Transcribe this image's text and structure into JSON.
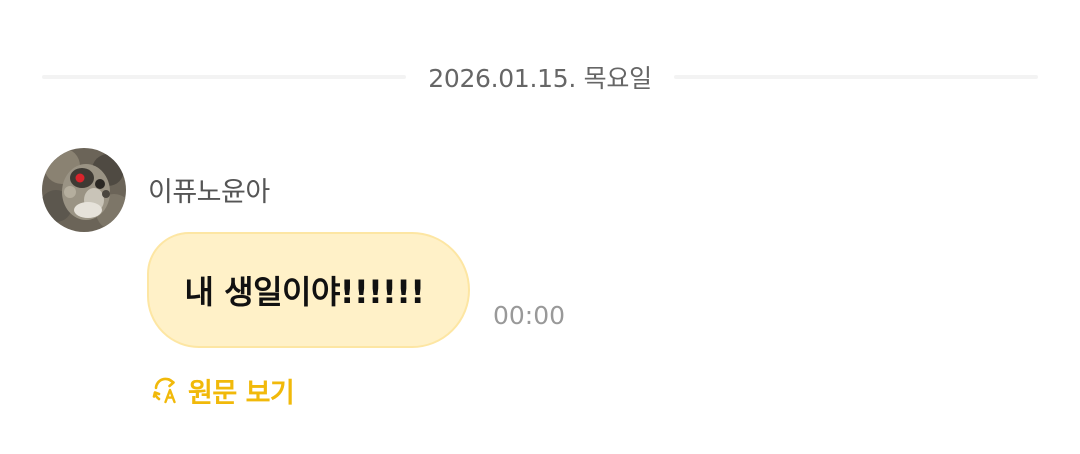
{
  "chat": {
    "date_divider": "2026.01.15. 목요일",
    "message": {
      "sender": "이퓨노윤아",
      "text": "내 생일이야!!!!!!",
      "time": "00:00",
      "translate_label": "원문 보기",
      "bubble_color": "#fff1c8",
      "accent_color": "#f1b90a"
    }
  },
  "icons": {
    "avatar": "profile-avatar",
    "translate": "translate-refresh-icon"
  }
}
